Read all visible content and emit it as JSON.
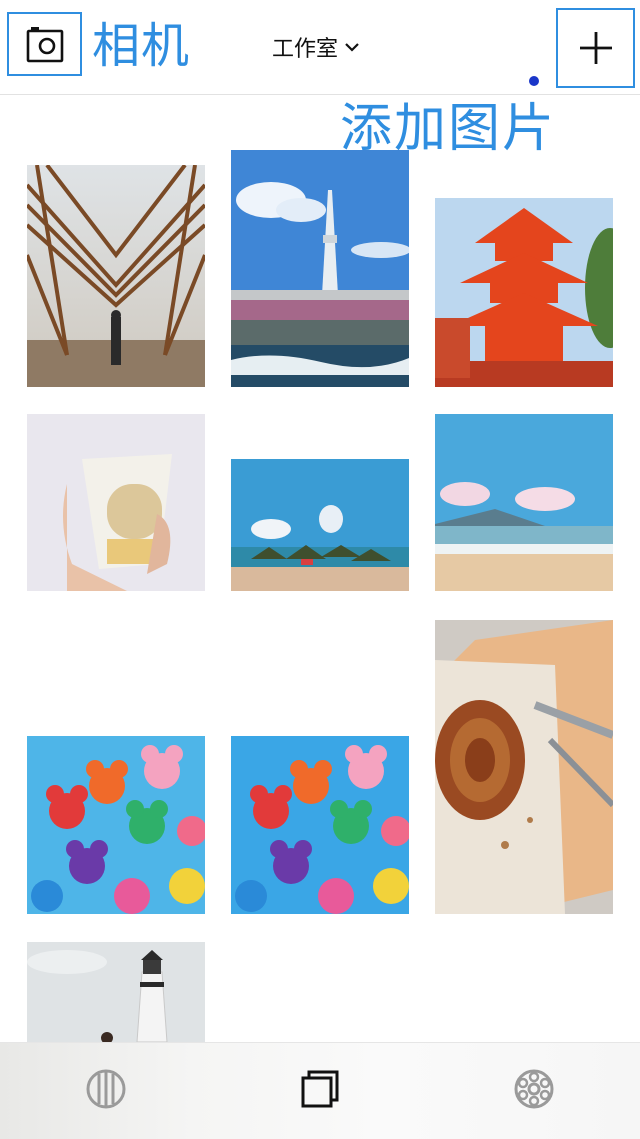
{
  "header": {
    "camera_annotation": "相机",
    "album_title": "工作室",
    "add_annotation": "添加图片",
    "icons": {
      "camera": "camera-icon",
      "dropdown": "chevron-down-icon",
      "add": "plus-icon"
    }
  },
  "colors": {
    "annotation": "#2f8ee0",
    "active_dot": "#1a36c9"
  },
  "gallery": {
    "photos": [
      "wooden-pavilion-photo",
      "tokyo-skytree-photo",
      "red-pagoda-photo",
      "pudding-cup-photo",
      "beach-umbrellas-photo",
      "beach-shore-photo",
      "mickey-balloons-photo-1",
      "mickey-balloons-photo-2",
      "pastry-plate-photo",
      "lighthouse-photo"
    ]
  },
  "tabbar": {
    "tabs": [
      "grid-circle-icon",
      "layers-icon",
      "settings-wheel-icon"
    ],
    "active_tab": "settings-wheel-icon"
  }
}
